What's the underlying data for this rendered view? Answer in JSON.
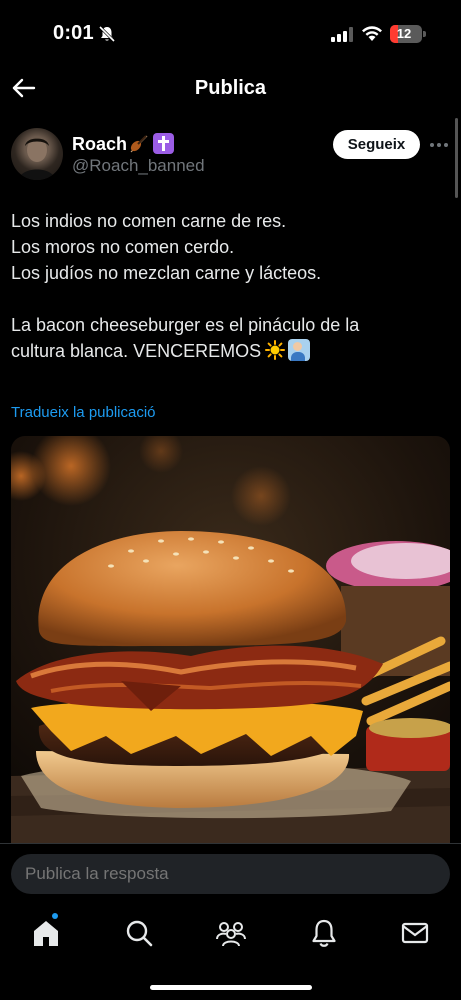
{
  "status_bar": {
    "time": "0:01",
    "battery_level": "12",
    "icons": [
      "bell-off-icon",
      "signal-icon",
      "wifi-icon",
      "battery-icon"
    ]
  },
  "header": {
    "title": "Publica",
    "back_icon": "arrow-left-icon"
  },
  "post": {
    "author": {
      "display_name": "Roach",
      "name_emojis": [
        "violin-emoji",
        "latin-cross-emoji"
      ],
      "handle": "@Roach_banned"
    },
    "follow_label": "Segueix",
    "more_icon": "more-horizontal-icon",
    "text_lines": [
      "Los indios no comen carne de res.",
      "Los moros no comen cerdo.",
      "Los judíos no mezclan carne y lácteos.",
      "La bacon cheeseburger es el pináculo de la",
      "cultura blanca. VENCEREMOS"
    ],
    "text_emojis": [
      "sun-emoji",
      "person-raising-hand-emoji"
    ],
    "translate_label": "Tradueix la publicació",
    "image": "bacon-cheeseburger-photo"
  },
  "reply": {
    "placeholder": "Publica la resposta"
  },
  "bottom_nav": {
    "items": [
      "home-icon",
      "search-icon",
      "communities-icon",
      "notifications-icon",
      "messages-icon"
    ],
    "active": "home-icon"
  },
  "colors": {
    "background": "#000000",
    "text": "#e7e9ea",
    "muted": "#71767b",
    "link": "#1d9bf0"
  }
}
